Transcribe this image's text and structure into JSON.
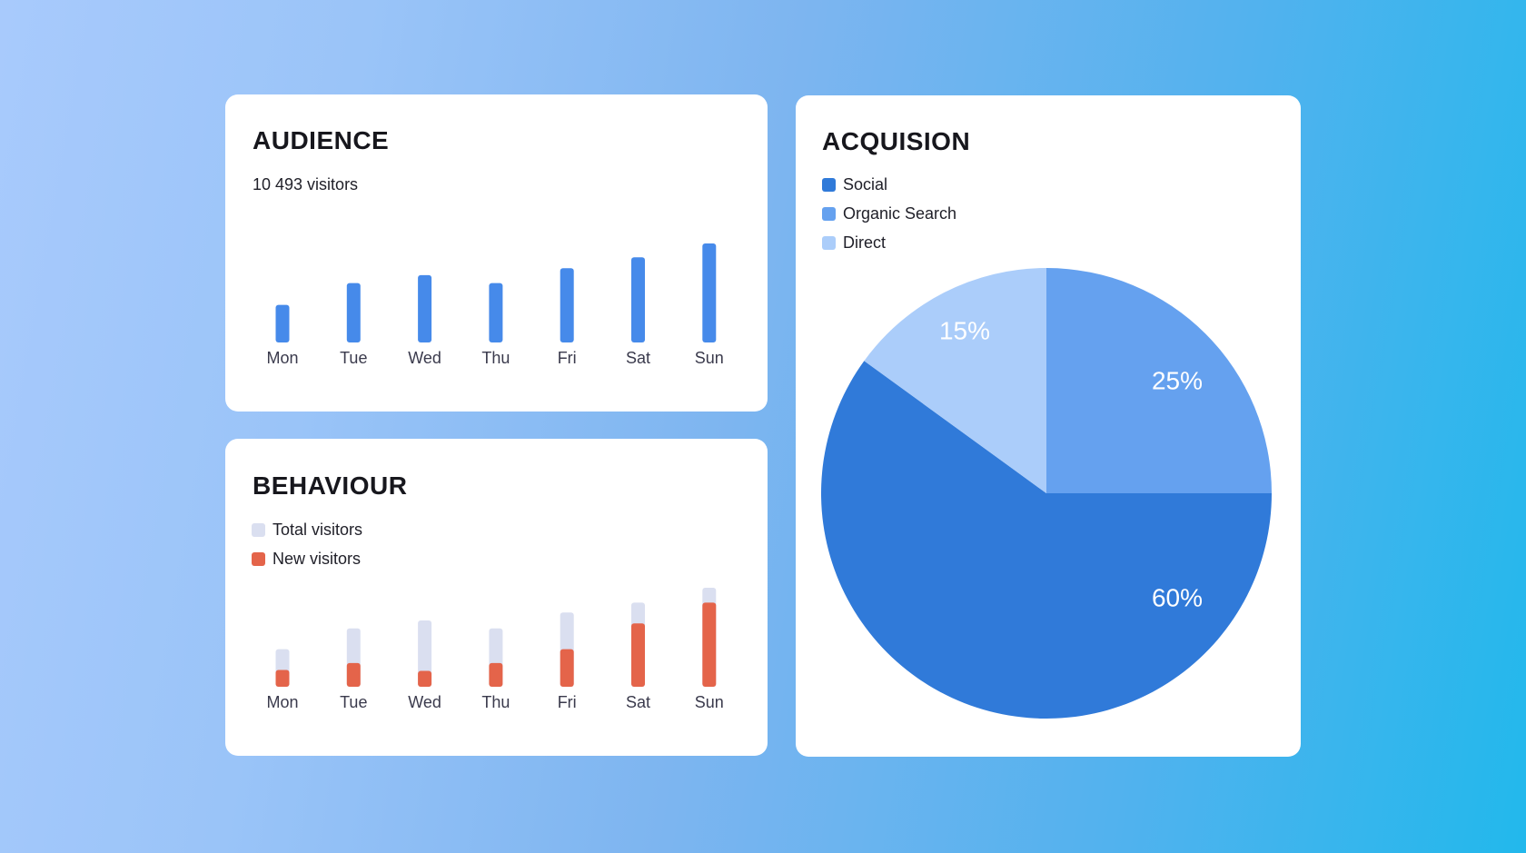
{
  "background": {
    "gradient_start": "#a8cafc",
    "gradient_end": "#22b8ec"
  },
  "audience": {
    "title": "AUDIENCE",
    "subtitle": "10 493 visitors",
    "bar_color": "#468aea"
  },
  "behaviour": {
    "title": "BEHAVIOUR",
    "legend": [
      {
        "label": "Total visitors",
        "color": "#dadff0"
      },
      {
        "label": "New visitors",
        "color": "#e4644a"
      }
    ]
  },
  "acquisition": {
    "title": "ACQUISION",
    "legend": [
      {
        "label": "Social",
        "color": "#307ad9"
      },
      {
        "label": "Organic Search",
        "color": "#65a1ef"
      },
      {
        "label": "Direct",
        "color": "#abcdfa"
      }
    ]
  },
  "chart_data": [
    {
      "id": "audience",
      "type": "bar",
      "title": "AUDIENCE",
      "subtitle": "10 493 visitors",
      "xlabel": "",
      "ylabel": "",
      "categories": [
        "Mon",
        "Tue",
        "Wed",
        "Thu",
        "Fri",
        "Sat",
        "Sun"
      ],
      "values": [
        38,
        60,
        68,
        60,
        75,
        86,
        100
      ],
      "value_units": "relative (Sun = 100), no axis shown",
      "ylim": [
        0,
        100
      ],
      "grid": false,
      "legend": "none"
    },
    {
      "id": "behaviour",
      "type": "bar",
      "title": "BEHAVIOUR",
      "xlabel": "",
      "ylabel": "",
      "categories": [
        "Mon",
        "Tue",
        "Wed",
        "Thu",
        "Fri",
        "Sat",
        "Sun"
      ],
      "series": [
        {
          "name": "Total visitors",
          "values": [
            38,
            59,
            67,
            59,
            75,
            85,
            100
          ]
        },
        {
          "name": "New visitors",
          "values": [
            17,
            24,
            16,
            24,
            38,
            64,
            85
          ]
        }
      ],
      "value_units": "relative (Sun total = 100), no axis shown",
      "overlay": true,
      "ylim": [
        0,
        100
      ],
      "grid": false,
      "legend": "top-left"
    },
    {
      "id": "acquisition",
      "type": "pie",
      "title": "ACQUISION",
      "labels": [
        "Organic Search",
        "Social",
        "Direct"
      ],
      "values": [
        25,
        60,
        15
      ],
      "data_labels": [
        "25%",
        "60%",
        "15%"
      ],
      "start": "12 o'clock, clockwise",
      "legend": "top-left"
    }
  ]
}
